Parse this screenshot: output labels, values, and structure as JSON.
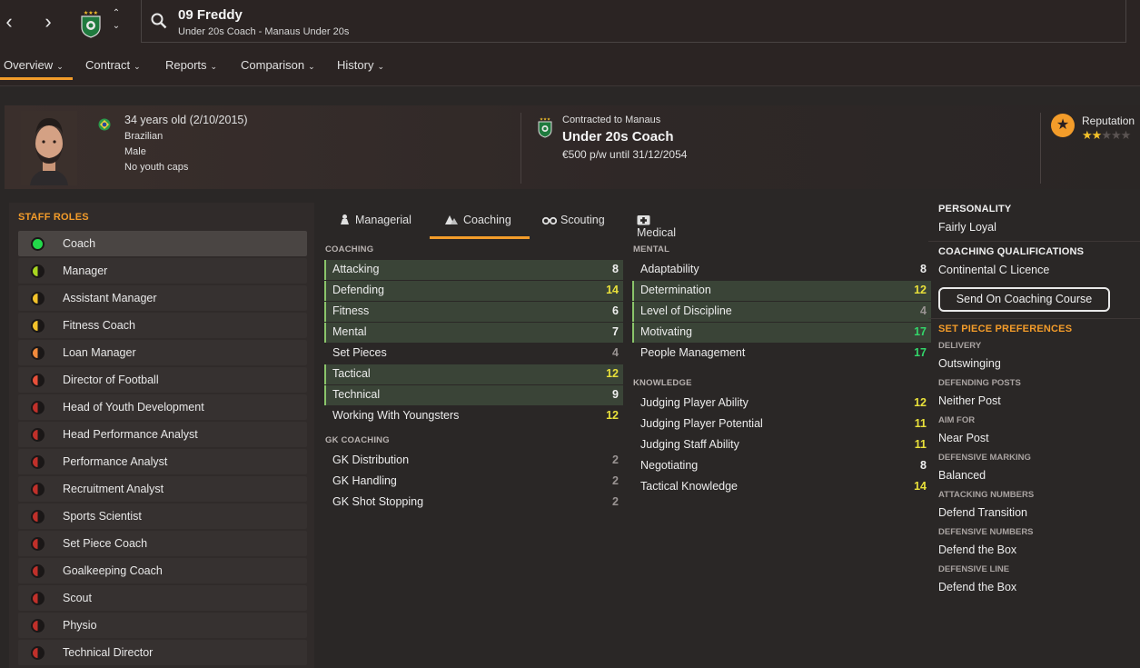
{
  "header": {
    "name": "09 Freddy",
    "subtitle": "Under 20s Coach - Manaus Under 20s"
  },
  "tabs": [
    {
      "label": "Overview"
    },
    {
      "label": "Contract"
    },
    {
      "label": "Reports"
    },
    {
      "label": "Comparison"
    },
    {
      "label": "History"
    }
  ],
  "profile": {
    "age": "34 years old (2/10/2015)",
    "nationality": "Brazilian",
    "gender": "Male",
    "caps": "No youth caps",
    "contract_label": "Contracted to Manaus",
    "role": "Under 20s Coach",
    "pay": "€500 p/w until 31/12/2054",
    "reputation_label": "Reputation",
    "reputation_stars": 2
  },
  "staff_roles": {
    "title": "STAFF ROLES",
    "items": [
      {
        "label": "Coach",
        "color": "#22d94a",
        "selected": true
      },
      {
        "label": "Manager",
        "color": "#a8d620"
      },
      {
        "label": "Assistant Manager",
        "color": "#f2c22a"
      },
      {
        "label": "Fitness Coach",
        "color": "#f2c22a"
      },
      {
        "label": "Loan Manager",
        "color": "#f08a3c"
      },
      {
        "label": "Director of Football",
        "color": "#e8503a"
      },
      {
        "label": "Head of Youth Development",
        "color": "#c0302a"
      },
      {
        "label": "Head Performance Analyst",
        "color": "#c0302a"
      },
      {
        "label": "Performance Analyst",
        "color": "#c0302a"
      },
      {
        "label": "Recruitment Analyst",
        "color": "#c0302a"
      },
      {
        "label": "Sports Scientist",
        "color": "#c0302a"
      },
      {
        "label": "Set Piece Coach",
        "color": "#c0302a"
      },
      {
        "label": "Goalkeeping Coach",
        "color": "#c0302a"
      },
      {
        "label": "Scout",
        "color": "#c0302a"
      },
      {
        "label": "Physio",
        "color": "#c0302a"
      },
      {
        "label": "Technical Director",
        "color": "#c0302a"
      }
    ]
  },
  "attr_tabs": [
    {
      "label": "Managerial",
      "icon": "managerial-icon"
    },
    {
      "label": "Coaching",
      "icon": "coaching-icon"
    },
    {
      "label": "Scouting",
      "icon": "binoculars-icon"
    },
    {
      "label": "Medical",
      "icon": "medical-icon"
    }
  ],
  "coaching": {
    "title": "COACHING",
    "items": [
      {
        "label": "Attacking",
        "value": "8",
        "hl": true
      },
      {
        "label": "Defending",
        "value": "14",
        "hl": true
      },
      {
        "label": "Fitness",
        "value": "6",
        "hl": true
      },
      {
        "label": "Mental",
        "value": "7",
        "hl": true
      },
      {
        "label": "Set Pieces",
        "value": "4",
        "hl": false
      },
      {
        "label": "Tactical",
        "value": "12",
        "hl": true
      },
      {
        "label": "Technical",
        "value": "9",
        "hl": true
      },
      {
        "label": "Working With Youngsters",
        "value": "12",
        "hl": false
      }
    ]
  },
  "gk_coaching": {
    "title": "GK COACHING",
    "items": [
      {
        "label": "GK Distribution",
        "value": "2"
      },
      {
        "label": "GK Handling",
        "value": "2"
      },
      {
        "label": "GK Shot Stopping",
        "value": "2"
      }
    ]
  },
  "mental": {
    "title": "MENTAL",
    "items": [
      {
        "label": "Adaptability",
        "value": "8",
        "hl": false
      },
      {
        "label": "Determination",
        "value": "12",
        "hl": true
      },
      {
        "label": "Level of Discipline",
        "value": "4",
        "hl": true
      },
      {
        "label": "Motivating",
        "value": "17",
        "hl": true
      },
      {
        "label": "People Management",
        "value": "17",
        "hl": false
      }
    ]
  },
  "knowledge": {
    "title": "KNOWLEDGE",
    "items": [
      {
        "label": "Judging Player Ability",
        "value": "12"
      },
      {
        "label": "Judging Player Potential",
        "value": "11"
      },
      {
        "label": "Judging Staff Ability",
        "value": "11"
      },
      {
        "label": "Negotiating",
        "value": "8"
      },
      {
        "label": "Tactical Knowledge",
        "value": "14"
      }
    ]
  },
  "right": {
    "personality_h": "PERSONALITY",
    "personality": "Fairly Loyal",
    "qual_h": "COACHING QUALIFICATIONS",
    "qual": "Continental C Licence",
    "course_btn": "Send On Coaching Course",
    "setpiece_h": "SET PIECE PREFERENCES",
    "prefs": [
      {
        "label": "DELIVERY",
        "value": "Outswinging"
      },
      {
        "label": "DEFENDING POSTS",
        "value": "Neither Post"
      },
      {
        "label": "AIM FOR",
        "value": "Near Post"
      },
      {
        "label": "DEFENSIVE MARKING",
        "value": "Balanced"
      },
      {
        "label": "ATTACKING NUMBERS",
        "value": "Defend Transition"
      },
      {
        "label": "DEFENSIVE NUMBERS",
        "value": "Defend the Box"
      },
      {
        "label": "DEFENSIVE LINE",
        "value": "Defend the Box"
      }
    ]
  }
}
